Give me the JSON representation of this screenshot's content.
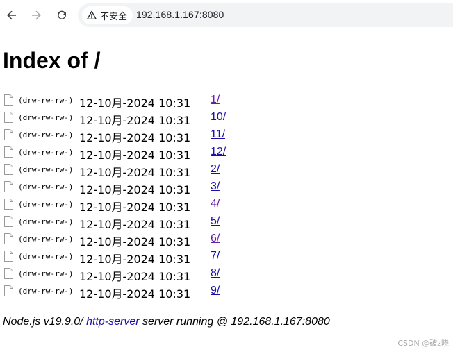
{
  "browser": {
    "security_label": "不安全",
    "url": "192.168.1.167:8080"
  },
  "page": {
    "title": "Index of /",
    "entries": [
      {
        "perm": "(drw-rw-rw-)",
        "mtime": "12-10月-2024 10:31",
        "name": "1/"
      },
      {
        "perm": "(drw-rw-rw-)",
        "mtime": "12-10月-2024 10:31",
        "name": "10/"
      },
      {
        "perm": "(drw-rw-rw-)",
        "mtime": "12-10月-2024 10:31",
        "name": "11/"
      },
      {
        "perm": "(drw-rw-rw-)",
        "mtime": "12-10月-2024 10:31",
        "name": "12/"
      },
      {
        "perm": "(drw-rw-rw-)",
        "mtime": "12-10月-2024 10:31",
        "name": "2/"
      },
      {
        "perm": "(drw-rw-rw-)",
        "mtime": "12-10月-2024 10:31",
        "name": "3/"
      },
      {
        "perm": "(drw-rw-rw-)",
        "mtime": "12-10月-2024 10:31",
        "name": "4/"
      },
      {
        "perm": "(drw-rw-rw-)",
        "mtime": "12-10月-2024 10:31",
        "name": "5/"
      },
      {
        "perm": "(drw-rw-rw-)",
        "mtime": "12-10月-2024 10:31",
        "name": "6/"
      },
      {
        "perm": "(drw-rw-rw-)",
        "mtime": "12-10月-2024 10:31",
        "name": "7/"
      },
      {
        "perm": "(drw-rw-rw-)",
        "mtime": "12-10月-2024 10:31",
        "name": "8/"
      },
      {
        "perm": "(drw-rw-rw-)",
        "mtime": "12-10月-2024 10:31",
        "name": "9/"
      }
    ],
    "footer": {
      "prefix": "Node.js v19.9.0/ ",
      "link": "http-server",
      "suffix": " server running @ 192.168.1.167:8080"
    }
  },
  "watermark": "CSDN @破z晓",
  "icons": {
    "back": "back-arrow-icon",
    "forward": "forward-arrow-icon",
    "reload": "reload-icon",
    "security": "warning-icon",
    "entry": "file-icon"
  },
  "colors": {
    "link": "#1a0dab",
    "visited_link": "#681da8",
    "omnibox_bg": "#f1f3f4"
  }
}
